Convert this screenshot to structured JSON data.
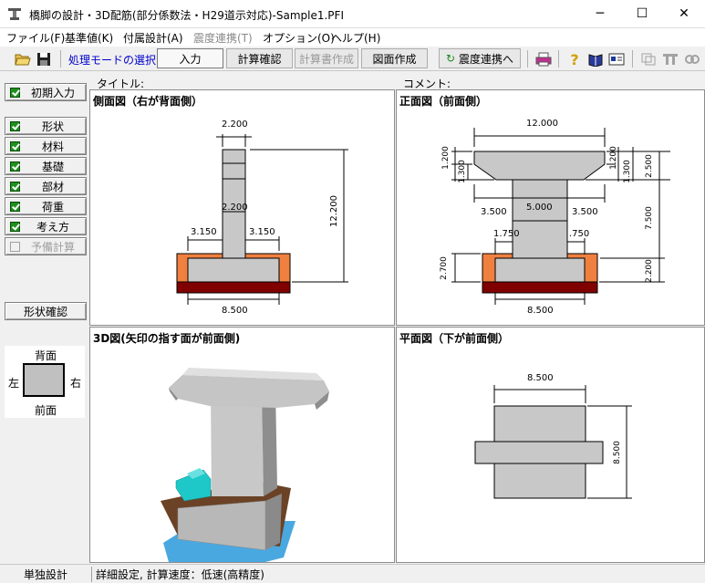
{
  "window": {
    "title": "橋脚の設計・3D配筋(部分係数法・H29道示対応)-Sample1.PFI",
    "minimize": "─",
    "maximize": "☐",
    "close": "✕"
  },
  "menu": [
    {
      "label": "ファイル(F)",
      "enabled": true
    },
    {
      "label": "基準値(K)",
      "enabled": true
    },
    {
      "label": "付属設計(A)",
      "enabled": true
    },
    {
      "label": "震度連携(T)",
      "enabled": false
    },
    {
      "label": "オプション(O)",
      "enabled": true
    },
    {
      "label": "ヘルプ(H)",
      "enabled": true
    }
  ],
  "toolbar": {
    "mode_label": "処理モードの選択",
    "input": "入力",
    "calc_check": "計算確認",
    "report": "計算書作成",
    "drawing": "図面作成",
    "seismic_link": "震度連携へ"
  },
  "sidebar": {
    "initial_input": "初期入力",
    "items": [
      {
        "label": "形状",
        "checked": true,
        "enabled": true
      },
      {
        "label": "材料",
        "checked": true,
        "enabled": true
      },
      {
        "label": "基礎",
        "checked": true,
        "enabled": true
      },
      {
        "label": "部材",
        "checked": true,
        "enabled": true
      },
      {
        "label": "荷重",
        "checked": true,
        "enabled": true
      },
      {
        "label": "考え方",
        "checked": true,
        "enabled": true
      },
      {
        "label": "予備計算",
        "checked": false,
        "enabled": false
      }
    ],
    "shape_check": "形状確認",
    "orientation": {
      "back": "背面",
      "left": "左",
      "right": "右",
      "front": "前面"
    }
  },
  "header": {
    "title_label": "タイトル:",
    "comment_label": "コメント:"
  },
  "views": {
    "side": {
      "title": "側面図（右が背面側）",
      "dims": {
        "column_width": "2.200",
        "column_width2": "2.200",
        "left_overhang": "3.150",
        "right_overhang": "3.150",
        "footing_width": "8.500",
        "height": "12.200"
      }
    },
    "front": {
      "title": "正面図（前面側）",
      "dims": {
        "beam_width": "12.000",
        "left_cant_top": "1.200",
        "left_cant_bottom": "1.300",
        "right_cant_top": "1.200",
        "right_cant_bottom": "1.300",
        "beam_height": "2.500",
        "left_beam": "3.500",
        "column_width": "5.000",
        "right_beam": "3.500",
        "column_height": "7.500",
        "left_footing": "1.750",
        "right_footing": ".750",
        "footing_height_left": "2.700",
        "footing_height_right": "2.200",
        "footing_width": "8.500"
      }
    },
    "view3d": {
      "title": "3D図(矢印の指す面が前面側)"
    },
    "plan": {
      "title": "平面図（下が前面側）",
      "dims": {
        "width": "8.500",
        "depth": "8.500"
      }
    }
  },
  "status": {
    "mode": "単独設計",
    "detail": "詳細設定, 計算速度：低速(高精度)"
  },
  "colors": {
    "concrete": "#c8c8c8",
    "soil": "#f08040",
    "base": "#800000",
    "accent": "#0000cc"
  }
}
